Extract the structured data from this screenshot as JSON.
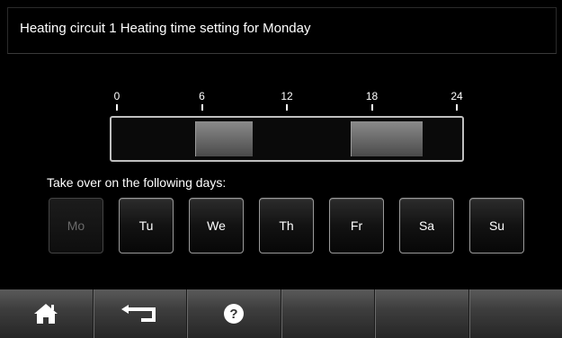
{
  "header": {
    "title": "Heating circuit 1 Heating time setting for Monday"
  },
  "timeline": {
    "ticks": [
      "0",
      "6",
      "12",
      "18",
      "24"
    ],
    "range_hours": [
      0,
      24
    ],
    "heating_periods": [
      {
        "start_hour": 5.5,
        "end_hour": 9.5
      },
      {
        "start_hour": 16.5,
        "end_hour": 21.5
      }
    ]
  },
  "takeover": {
    "label": "Take over on the following days:",
    "days": [
      {
        "label": "Mo",
        "enabled": false
      },
      {
        "label": "Tu",
        "enabled": true
      },
      {
        "label": "We",
        "enabled": true
      },
      {
        "label": "Th",
        "enabled": true
      },
      {
        "label": "Fr",
        "enabled": true
      },
      {
        "label": "Sa",
        "enabled": true
      },
      {
        "label": "Su",
        "enabled": true
      }
    ]
  },
  "toolbar": {
    "buttons": [
      {
        "icon": "home-icon"
      },
      {
        "icon": "back-icon"
      },
      {
        "icon": "help-icon"
      },
      {
        "icon": ""
      },
      {
        "icon": ""
      },
      {
        "icon": ""
      }
    ]
  },
  "colors": {
    "background": "#000000",
    "text": "#ffffff",
    "disabled_text": "#6a6a6a",
    "heating_block": "#7a7a7a"
  }
}
